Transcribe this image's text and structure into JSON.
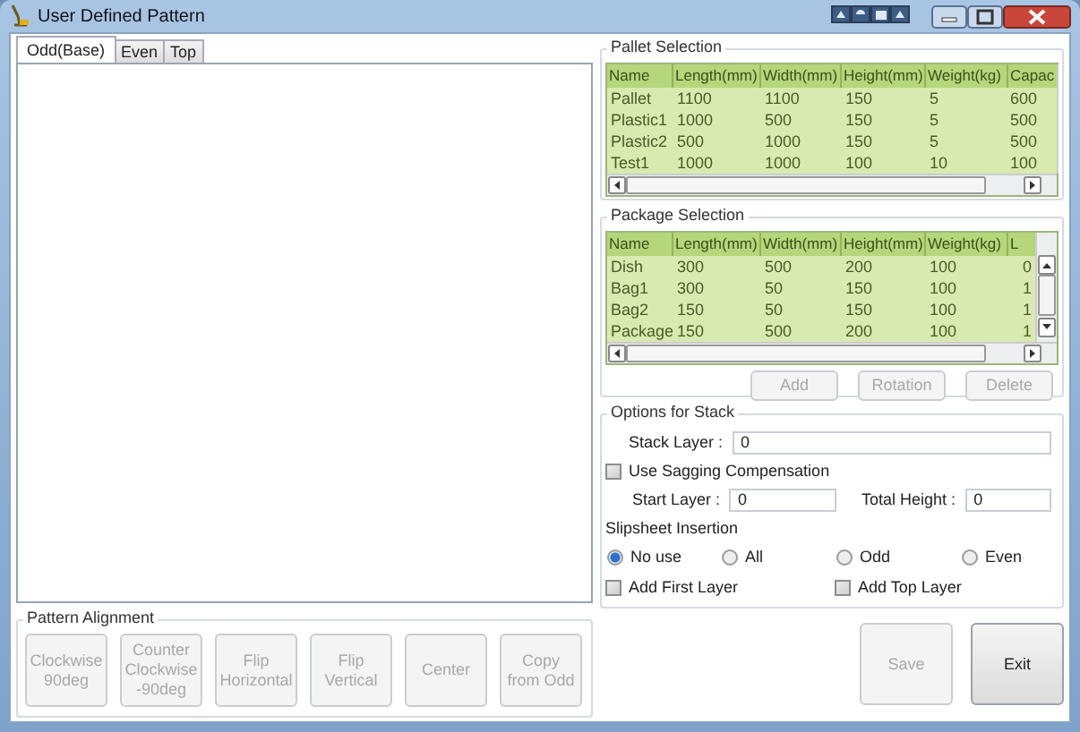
{
  "window": {
    "title": "User Defined Pattern"
  },
  "tabs": [
    {
      "label": "Odd(Base)",
      "selected": true
    },
    {
      "label": "Even",
      "selected": false
    },
    {
      "label": "Top",
      "selected": false
    }
  ],
  "pattern_alignment": {
    "title": "Pattern Alignment",
    "buttons": [
      {
        "label": "Clockwise\n90deg",
        "disabled": true
      },
      {
        "label": "Counter\nClockwise\n-90deg",
        "disabled": true
      },
      {
        "label": "Flip\nHorizontal",
        "disabled": true
      },
      {
        "label": "Flip\nVertical",
        "disabled": true
      },
      {
        "label": "Center",
        "disabled": true
      },
      {
        "label": "Copy\nfrom Odd",
        "disabled": true
      }
    ]
  },
  "pallet_selection": {
    "title": "Pallet Selection",
    "columns": [
      "Name",
      "Length(mm)",
      "Width(mm)",
      "Height(mm)",
      "Weight(kg)",
      "Capac"
    ],
    "rows": [
      [
        "Pallet",
        "1100",
        "1100",
        "150",
        "5",
        "600"
      ],
      [
        "Plastic1",
        "1000",
        "500",
        "150",
        "5",
        "500"
      ],
      [
        "Plastic2",
        "500",
        "1000",
        "150",
        "5",
        "500"
      ],
      [
        "Test1",
        "1000",
        "1000",
        "100",
        "10",
        "100"
      ]
    ]
  },
  "package_selection": {
    "title": "Package Selection",
    "columns": [
      "Name",
      "Length(mm)",
      "Width(mm)",
      "Height(mm)",
      "Weight(kg)",
      "L"
    ],
    "rows": [
      [
        "Dish",
        "300",
        "500",
        "200",
        "100",
        "0"
      ],
      [
        "Bag1",
        "300",
        "50",
        "150",
        "100",
        "1"
      ],
      [
        "Bag2",
        "150",
        "50",
        "150",
        "100",
        "1"
      ],
      [
        "Package",
        "150",
        "500",
        "200",
        "100",
        "1"
      ]
    ],
    "buttons": [
      {
        "label": "Add",
        "disabled": true
      },
      {
        "label": "Rotation",
        "disabled": true
      },
      {
        "label": "Delete",
        "disabled": true
      }
    ]
  },
  "options_for_stack": {
    "title": "Options for Stack",
    "stack_layer": {
      "label": "Stack Layer :",
      "value": "0"
    },
    "sagging_compensation": {
      "label": "Use Sagging Compensation",
      "checked": false
    },
    "start_layer": {
      "label": "Start Layer :",
      "value": "0"
    },
    "total_height": {
      "label": "Total Height :",
      "value": "0"
    },
    "slipsheet": {
      "title": "Slipsheet Insertion",
      "options": [
        {
          "label": "No use",
          "selected": true
        },
        {
          "label": "All",
          "selected": false
        },
        {
          "label": "Odd",
          "selected": false
        },
        {
          "label": "Even",
          "selected": false
        }
      ]
    },
    "add_first_layer": {
      "label": "Add First Layer",
      "checked": false
    },
    "add_top_layer": {
      "label": "Add Top Layer",
      "checked": false
    }
  },
  "actions": [
    {
      "label": "Save",
      "disabled": true
    },
    {
      "label": "Exit",
      "disabled": false
    }
  ]
}
